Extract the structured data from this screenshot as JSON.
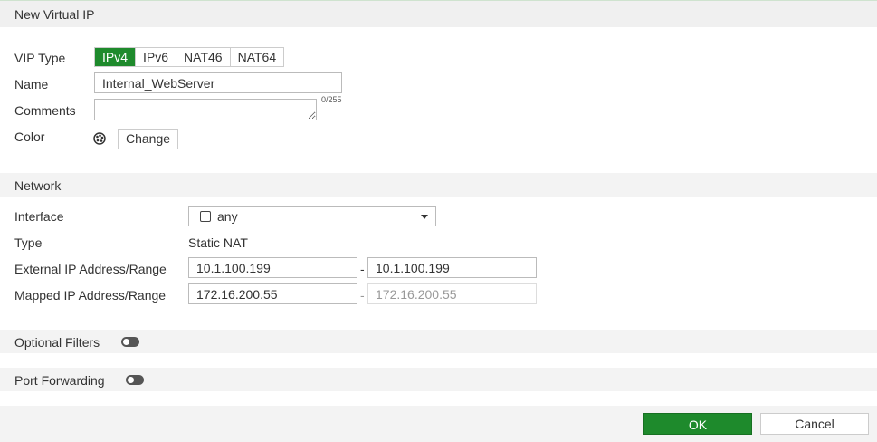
{
  "dialog": {
    "title": "New Virtual IP"
  },
  "general": {
    "vip_type_label": "VIP Type",
    "vip_types": [
      "IPv4",
      "IPv6",
      "NAT46",
      "NAT64"
    ],
    "vip_type_selected": "IPv4",
    "name_label": "Name",
    "name_value": "Internal_WebServer",
    "comments_label": "Comments",
    "comments_value": "",
    "comments_counter": "0/255",
    "color_label": "Color",
    "color_icon": "palette-icon",
    "change_label": "Change"
  },
  "network": {
    "section_title": "Network",
    "interface_label": "Interface",
    "interface_value": "any",
    "type_label": "Type",
    "type_value": "Static NAT",
    "external_label": "External IP Address/Range",
    "external_start": "10.1.100.199",
    "external_end": "10.1.100.199",
    "mapped_label": "Mapped IP Address/Range",
    "mapped_start": "172.16.200.55",
    "mapped_end": "172.16.200.55",
    "range_sep": "-"
  },
  "optional_filters": {
    "label": "Optional Filters",
    "enabled": false
  },
  "port_forwarding": {
    "label": "Port Forwarding",
    "enabled": false
  },
  "footer": {
    "ok_label": "OK",
    "cancel_label": "Cancel"
  },
  "colors": {
    "accent": "#1e8a2c",
    "section_bg": "#f3f3f3"
  }
}
